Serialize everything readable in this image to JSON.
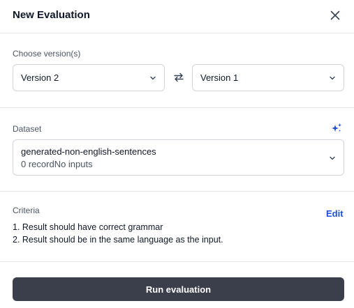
{
  "dialog": {
    "title": "New Evaluation",
    "close_icon": "close-icon"
  },
  "versions": {
    "label": "Choose version(s)",
    "left_selected": "Version 2",
    "right_selected": "Version 1",
    "swap_icon": "swap-arrows-icon"
  },
  "dataset": {
    "label": "Dataset",
    "name": "generated-non-english-sentences",
    "meta": "0 recordNo inputs",
    "sparkle_icon": "sparkles-icon",
    "accent_color": "#1d4ed8"
  },
  "criteria": {
    "label": "Criteria",
    "edit_label": "Edit",
    "items": [
      "1. Result should have correct grammar",
      "2. Result should be in the same language as the input."
    ]
  },
  "footer": {
    "run_label": "Run evaluation",
    "button_color": "#3a3f4b"
  }
}
